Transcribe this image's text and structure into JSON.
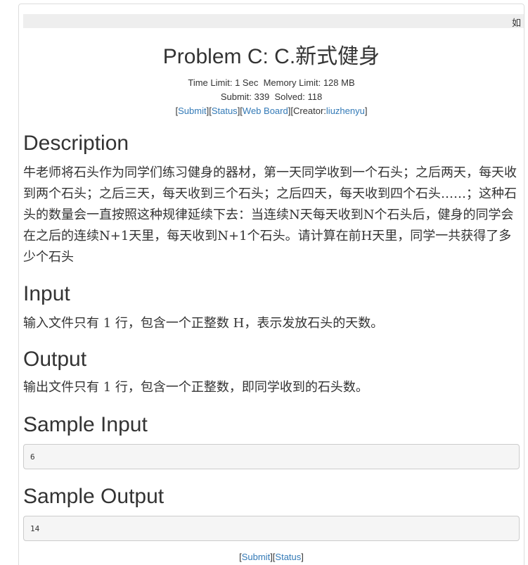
{
  "topbar": {
    "marquee_text": "如"
  },
  "problem": {
    "title": "Problem C: C.新式健身",
    "time_limit_label": "Time Limit:",
    "time_limit": "1 Sec",
    "memory_limit_label": "Memory Limit:",
    "memory_limit": "128 MB",
    "submit_label": "Submit:",
    "submit_count": "339",
    "solved_label": "Solved:",
    "solved_count": "118"
  },
  "links": {
    "submit": "Submit",
    "status": "Status",
    "web_board": "Web Board",
    "creator_label": "Creator:",
    "creator": "liuzhenyu"
  },
  "sections": {
    "description_heading": "Description",
    "description_text": "牛老师将石头作为同学们练习健身的器材，第一天同学收到一个石头；之后两天，每天收到两个石头；之后三天，每天收到三个石头；之后四天，每天收到四个石头……；这种石头的数量会一直按照这种规律延续下去：当连续N天每天收到N个石头后，健身的同学会在之后的连续N+1天里，每天收到N+1个石头。请计算在前H天里，同学一共获得了多少个石头",
    "input_heading": "Input",
    "input_text": "输入文件只有 1 行，包含一个正整数 H，表示发放石头的天数。",
    "output_heading": "Output",
    "output_text": "输出文件只有 1 行，包含一个正整数，即同学收到的石头数。",
    "sample_input_heading": "Sample Input",
    "sample_input": "6",
    "sample_output_heading": "Sample Output",
    "sample_output": "14"
  }
}
